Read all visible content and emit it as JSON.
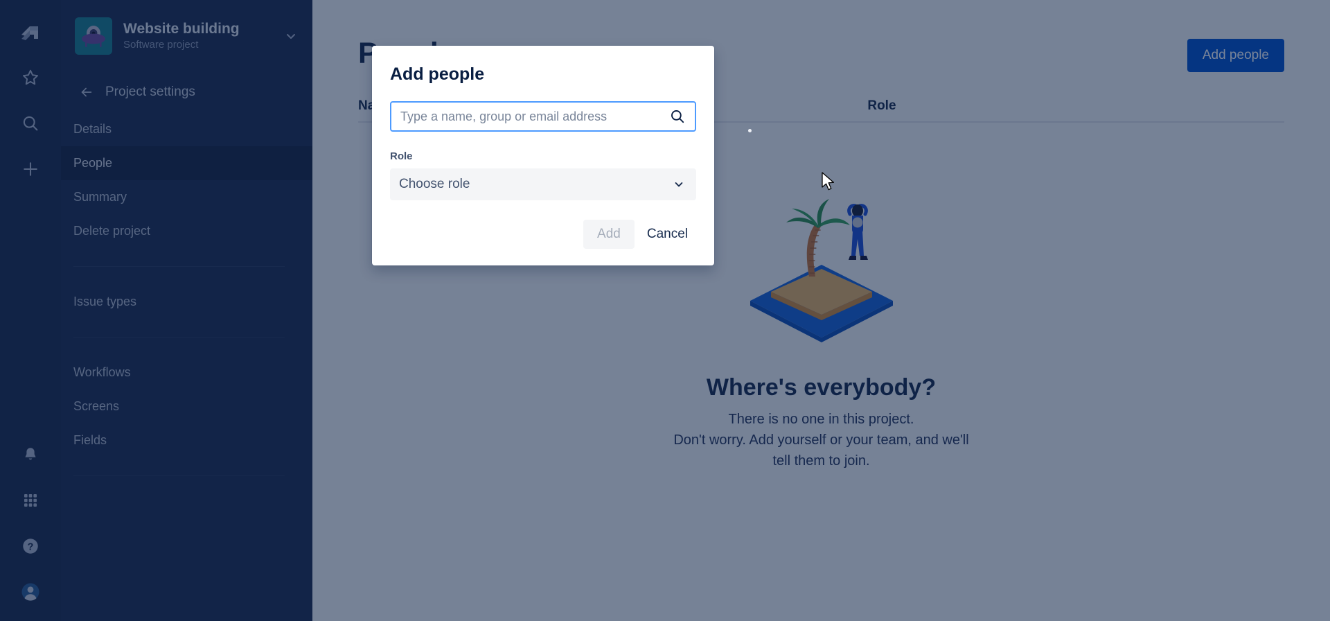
{
  "rail": {
    "logo_icon": "jira-logo-icon",
    "items": [
      {
        "icon": "star-icon",
        "name": "starred"
      },
      {
        "icon": "search-icon",
        "name": "search"
      },
      {
        "icon": "plus-icon",
        "name": "create"
      }
    ],
    "bottom_items": [
      {
        "icon": "bell-icon",
        "name": "notifications"
      },
      {
        "icon": "apps-grid-icon",
        "name": "app-switcher"
      },
      {
        "icon": "help-icon",
        "name": "help"
      },
      {
        "icon": "avatar-icon",
        "name": "profile"
      }
    ]
  },
  "sidebar": {
    "project_name": "Website building",
    "project_type": "Software project",
    "project_avatar_icon": "ufo-icon",
    "chevron_icon": "chevron-down-icon",
    "back_icon": "arrow-left-icon",
    "settings_title": "Project settings",
    "nav_group_1": [
      {
        "label": "Details",
        "active": false
      },
      {
        "label": "People",
        "active": true
      },
      {
        "label": "Summary",
        "active": false
      },
      {
        "label": "Delete project",
        "active": false
      }
    ],
    "nav_group_2": [
      {
        "label": "Issue types",
        "active": false
      }
    ],
    "nav_group_3": [
      {
        "label": "Workflows",
        "active": false
      },
      {
        "label": "Screens",
        "active": false
      },
      {
        "label": "Fields",
        "active": false
      }
    ]
  },
  "main": {
    "page_title": "People",
    "add_people_button": "Add people",
    "table": {
      "columns": [
        {
          "label": "Name",
          "sortable": true,
          "sort_icon": "sort-ascending-icon"
        },
        {
          "label": "Role",
          "sortable": false
        }
      ]
    },
    "empty_state": {
      "illustration": "desert-island-illustration",
      "title": "Where's everybody?",
      "line_1": "There is no one in this project.",
      "line_2": "Don't worry. Add yourself or your team, and we'll",
      "line_3": "tell them to join."
    }
  },
  "modal": {
    "title": "Add people",
    "search": {
      "placeholder": "Type a name, group or email address",
      "value": "",
      "icon": "search-icon"
    },
    "role": {
      "label": "Role",
      "selected": "Choose role",
      "chevron_icon": "chevron-down-icon"
    },
    "add_button": "Add",
    "cancel_button": "Cancel"
  },
  "colors": {
    "brand_blue": "#0052cc",
    "sidebar_dark": "#1d2c50",
    "rail_dark": "#1b2a4b",
    "focus_blue": "#4c9aff",
    "text_dark": "#172b4d",
    "avatar_teal": "#1a7f8e"
  }
}
